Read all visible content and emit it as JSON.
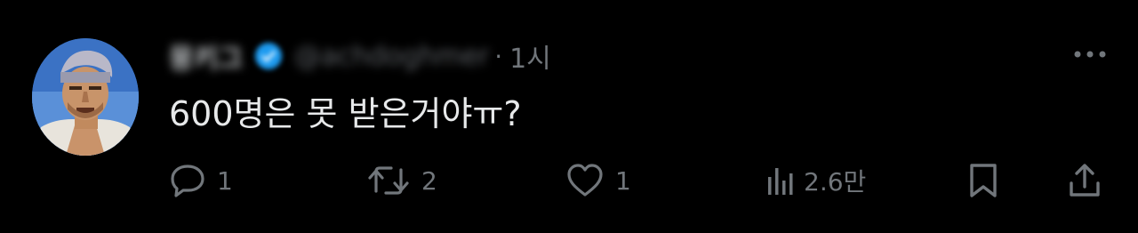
{
  "tweet": {
    "display_name": "뭉키그",
    "handle": "@achdoghmer",
    "separator": "·",
    "time": "1시",
    "text": "600명은 못 받은거야ㅠ?"
  },
  "actions": {
    "reply_count": "1",
    "retweet_count": "2",
    "like_count": "1",
    "views_count": "2.6만"
  },
  "icons": {
    "verified": "verified-badge-icon",
    "more": "more-dots-icon",
    "reply": "reply-icon",
    "retweet": "retweet-icon",
    "like": "heart-icon",
    "views": "views-chart-icon",
    "bookmark": "bookmark-icon",
    "share": "share-icon"
  },
  "colors": {
    "background": "#000000",
    "text": "#e7e9ea",
    "muted": "#71767b",
    "verified": "#1d9bf0"
  }
}
